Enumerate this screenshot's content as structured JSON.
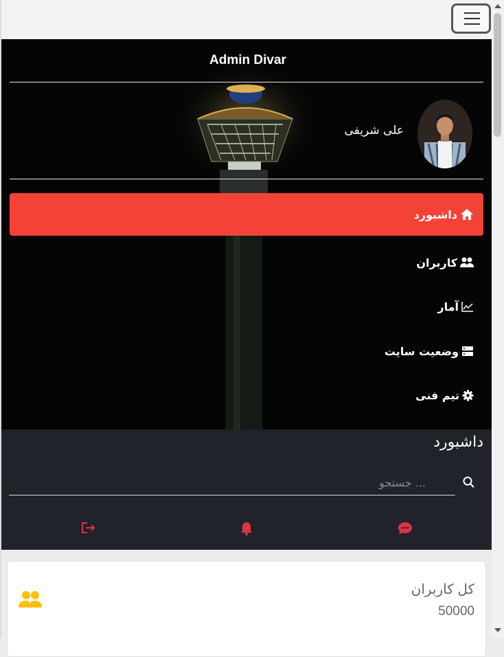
{
  "sidebar": {
    "brand": "Admin Divar",
    "user_name": "علی شریفی",
    "items": [
      {
        "label": "داشبورد",
        "icon": "home-icon",
        "active": true
      },
      {
        "label": "کاربران",
        "icon": "users-icon",
        "active": false
      },
      {
        "label": "آمار",
        "icon": "chart-line-icon",
        "active": false
      },
      {
        "label": "وضعیت سایت",
        "icon": "server-icon",
        "active": false
      },
      {
        "label": "تیم فنی",
        "icon": "gear-icon",
        "active": false
      }
    ]
  },
  "header": {
    "title": "داشبورد",
    "search_placeholder": "جستجو ...",
    "actions": [
      {
        "icon": "logout-icon"
      },
      {
        "icon": "bell-icon"
      },
      {
        "icon": "chat-icon"
      }
    ]
  },
  "stats": {
    "total_users_label": "کل کاربران",
    "total_users_value": "50000",
    "icon": "users-icon"
  },
  "colors": {
    "accent": "#f44336",
    "sidebar_bg": "#050505",
    "header_bg": "#202329",
    "icon_red": "#dc3545",
    "icon_yellow": "#ffc107",
    "card_text": "#666666"
  }
}
